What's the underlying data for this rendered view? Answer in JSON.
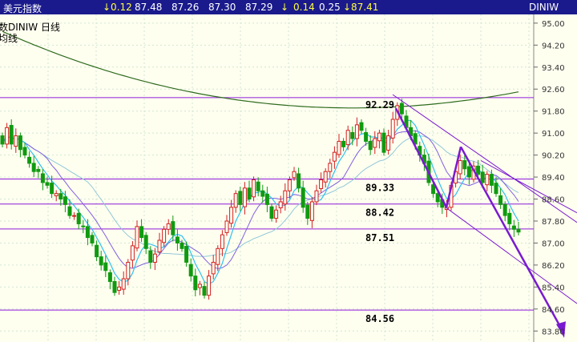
{
  "header": {
    "title": "美元指数",
    "change_a": "↓0.12",
    "price": "87.48",
    "high": "87.26",
    "low": "87.30",
    "close": "87.29",
    "change_b_arrow": "↓",
    "change_b": "0.14",
    "change_c": "0.25",
    "last": "↓87.41",
    "symbol": "DINIW"
  },
  "legend": {
    "line1": "数DINIW    日线",
    "line2": "均线"
  },
  "colors": {
    "background": "#fffff0",
    "grid": "#cfe6cf",
    "up": "#d22020",
    "down": "#109a10",
    "level_line": "#8c1ad8",
    "trend": "#7a1ad0",
    "ma_short": "#30c0f0",
    "ma_mid": "#8060e0",
    "ma_long": "#90c8d8",
    "ma_200": "#2e6b1e"
  },
  "chart_data": {
    "type": "candlestick",
    "yticks": [
      "95.00",
      "94.20",
      "93.40",
      "92.60",
      "91.80",
      "91.00",
      "90.20",
      "89.40",
      "88.60",
      "87.80",
      "87.00",
      "86.20",
      "85.40",
      "84.60",
      "83.80"
    ],
    "ylim": [
      83.4,
      95.2
    ],
    "levels": [
      {
        "value": 92.29,
        "label": "92.29"
      },
      {
        "value": 89.33,
        "label": "89.33"
      },
      {
        "value": 88.42,
        "label": "88.42"
      },
      {
        "value": 87.51,
        "label": "87.51"
      },
      {
        "value": 84.56,
        "label": "84.56"
      }
    ],
    "closes": [
      90.6,
      91.2,
      90.6,
      90.9,
      90.4,
      90.2,
      89.9,
      89.6,
      89.6,
      89.2,
      89.1,
      88.8,
      88.8,
      88.6,
      88.4,
      88.0,
      88.0,
      87.7,
      87.6,
      87.2,
      87.0,
      86.5,
      86.2,
      86.0,
      85.6,
      85.2,
      85.4,
      85.7,
      86.3,
      86.9,
      87.6,
      87.2,
      86.8,
      86.3,
      86.6,
      87.1,
      87.5,
      87.7,
      87.3,
      87.0,
      86.8,
      86.3,
      85.8,
      85.3,
      85.5,
      85.1,
      85.8,
      86.3,
      86.8,
      87.3,
      87.8,
      88.3,
      88.8,
      88.4,
      89.0,
      88.6,
      89.3,
      88.9,
      88.7,
      88.4,
      87.9,
      88.2,
      88.5,
      88.9,
      89.3,
      89.6,
      89.0,
      88.3,
      87.9,
      88.5,
      88.9,
      89.3,
      89.6,
      89.9,
      90.3,
      90.7,
      90.5,
      91.1,
      90.8,
      91.3,
      91.1,
      90.7,
      90.4,
      90.8,
      91.0,
      90.3,
      90.9,
      91.5,
      92.0,
      91.7,
      91.2,
      90.9,
      90.6,
      90.2,
      89.9,
      89.2,
      88.8,
      88.5,
      88.3,
      88.3,
      89.1,
      89.6,
      90.0,
      89.7,
      89.4,
      89.8,
      89.5,
      89.2,
      89.5,
      89.1,
      88.8,
      88.4,
      88.0,
      87.7,
      87.5,
      87.4
    ]
  }
}
